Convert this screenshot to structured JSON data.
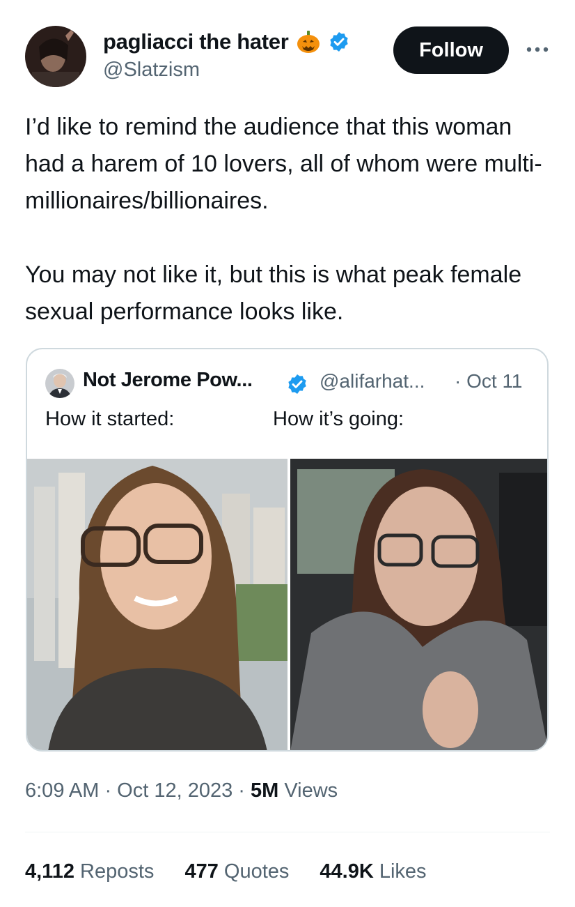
{
  "tweet": {
    "author": {
      "display_name": "pagliacci the hater",
      "handle": "@Slatzism",
      "emoji_icon": "pumpkin-icon",
      "verified_icon": "verified-badge-icon"
    },
    "follow_label": "Follow",
    "more_icon": "more-options-icon",
    "text_paragraphs": [
      "I’d like to remind the audience that this woman had a harem of 10 lovers, all of whom were multi-millionaires/billionaires.",
      "You may not like it, but this is what peak female sexual performance looks like."
    ],
    "timestamp": "6:09 AM · Oct 12, 2023 · ",
    "views_count": "5M",
    "views_label": " Views",
    "stats": [
      {
        "count": "4,112",
        "label": " Reposts"
      },
      {
        "count": "477",
        "label": " Quotes"
      },
      {
        "count": "44.9K",
        "label": " Likes"
      }
    ]
  },
  "quote": {
    "display_name": "Not Jerome Pow...",
    "handle": "@alifarhat...",
    "date": "· Oct 11",
    "text_left": "How it started:",
    "text_right": "How it’s going:"
  },
  "colors": {
    "text_primary": "#0f1419",
    "text_secondary": "#536471",
    "verified_blue": "#1d9bf0",
    "follow_bg": "#0f1419",
    "border": "#cfd9de"
  }
}
